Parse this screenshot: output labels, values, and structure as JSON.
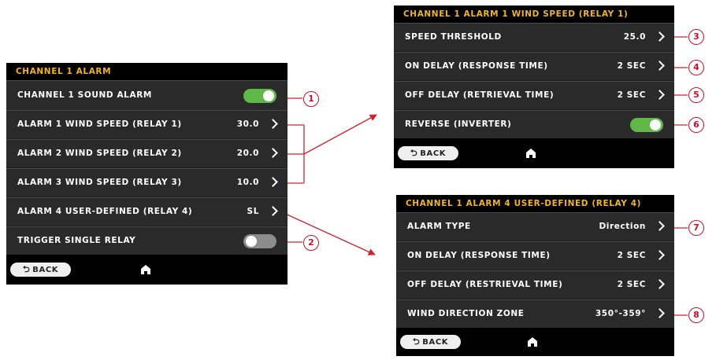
{
  "left_panel": {
    "header": "CHANNEL 1 ALARM",
    "rows": [
      {
        "label": "CHANNEL 1 SOUND ALARM",
        "toggle": "on"
      },
      {
        "label": "ALARM 1 WIND SPEED (RELAY 1)",
        "value": "30.0"
      },
      {
        "label": "ALARM 2 WIND SPEED (RELAY 2)",
        "value": "20.0"
      },
      {
        "label": "ALARM 3 WIND SPEED (RELAY 3)",
        "value": "10.0"
      },
      {
        "label": "ALARM 4 USER-DEFINED (RELAY 4)",
        "value": "SL"
      },
      {
        "label": "TRIGGER SINGLE RELAY",
        "toggle": "off"
      }
    ],
    "back_label": "BACK"
  },
  "top_right_panel": {
    "header": "CHANNEL 1 ALARM 1 WIND SPEED (RELAY 1)",
    "rows": [
      {
        "label": "SPEED THRESHOLD",
        "value": "25.0"
      },
      {
        "label": "ON DELAY (RESPONSE TIME)",
        "value": "2 SEC"
      },
      {
        "label": "OFF DELAY (RETRIEVAL TIME)",
        "value": "2 SEC"
      },
      {
        "label": "REVERSE (INVERTER)",
        "toggle": "on"
      }
    ],
    "back_label": "BACK"
  },
  "bottom_right_panel": {
    "header": "CHANNEL 1 ALARM 4 USER-DEFINED (RELAY 4)",
    "rows": [
      {
        "label": "ALARM TYPE",
        "value": "Direction"
      },
      {
        "label": "ON DELAY (RESPONSE TIME)",
        "value": "2 SEC"
      },
      {
        "label": "OFF DELAY (RESTRIEVAL TIME)",
        "value": "2 SEC"
      },
      {
        "label": "WIND DIRECTION ZONE",
        "value": "350°-359°"
      }
    ],
    "back_label": "BACK"
  },
  "callouts": [
    "1",
    "2",
    "3",
    "4",
    "5",
    "6",
    "7",
    "8"
  ],
  "icons": {
    "back": "return-arrow-icon",
    "home": "home-icon",
    "row": "chevron-right-icon"
  },
  "colors": {
    "accent": "#f0b32a",
    "toggle_on": "#5fb848",
    "toggle_off": "#8c8c8c",
    "callout": "#c8102e"
  }
}
